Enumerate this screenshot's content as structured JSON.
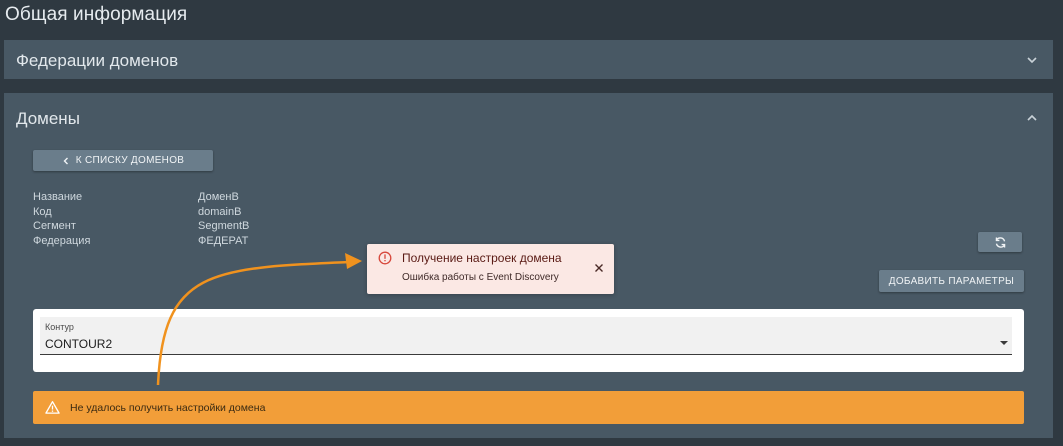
{
  "page": {
    "title": "Общая информация"
  },
  "federations_panel": {
    "title": "Федерации доменов",
    "icon": "chevron-down-icon"
  },
  "domains_panel": {
    "title": "Домены",
    "icon": "chevron-up-icon",
    "back_button": {
      "label": "К СПИСКУ ДОМЕНОВ",
      "icon": "chevron-left-icon"
    },
    "info": [
      {
        "label": "Название",
        "value": "ДоменB"
      },
      {
        "label": "Код",
        "value": "domainB"
      },
      {
        "label": "Сегмент",
        "value": "SegmentB"
      },
      {
        "label": "Федерация",
        "value": "ФЕДЕРАТ"
      }
    ],
    "refresh_button": {
      "icon": "refresh-icon"
    },
    "add_params_button": {
      "label": "ДОБАВИТЬ ПАРАМЕТРЫ"
    },
    "contour_select": {
      "label": "Контур",
      "value": "CONTOUR2"
    },
    "warning": {
      "text": "Не удалось получить настройки домена",
      "icon": "warning-icon",
      "color": "#f29e39"
    }
  },
  "toast": {
    "title": "Получение настроек домена",
    "message": "Ошибка работы с Event Discovery",
    "icon": "error-circle-icon",
    "color": "#fbe8e4"
  },
  "annotation": {
    "color": "#f0921e",
    "type": "arrow"
  }
}
